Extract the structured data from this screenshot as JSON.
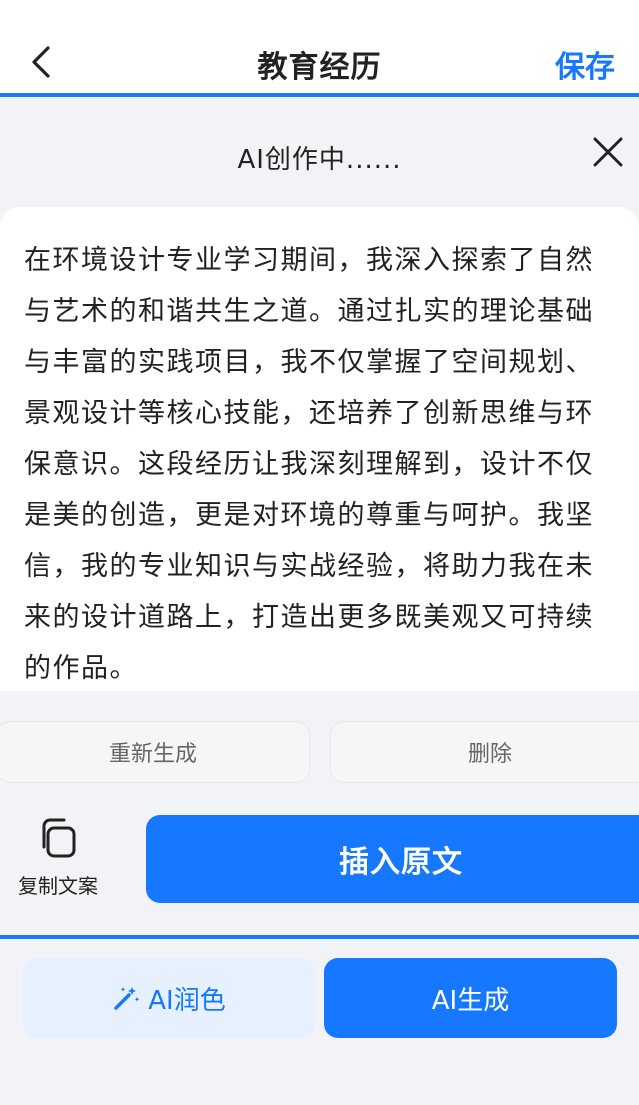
{
  "header": {
    "title": "教育经历",
    "save_label": "保存"
  },
  "ai_panel": {
    "status": "AI创作中......",
    "content": "在环境设计专业学习期间，我深入探索了自然与艺术的和谐共生之道。通过扎实的理论基础与丰富的实践项目，我不仅掌握了空间规划、景观设计等核心技能，还培养了创新思维与环保意识。这段经历让我深刻理解到，设计不仅是美的创造，更是对环境的尊重与呵护。我坚信，我的专业知识与实战经验，将助力我在未来的设计道路上，打造出更多既美观又可持续的作品。",
    "regenerate_label": "重新生成",
    "delete_label": "删除",
    "copy_label": "复制文案",
    "insert_label": "插入原文"
  },
  "bottom": {
    "polish_label": "AI润色",
    "generate_label": "AI生成"
  },
  "icons": {
    "back": "chevron-left-icon",
    "close": "close-icon",
    "copy": "copy-icon",
    "polish": "magic-wand-icon"
  },
  "colors": {
    "accent": "#1677ff",
    "accent_light": "#e6f0ff",
    "background": "#f2f3f7"
  }
}
